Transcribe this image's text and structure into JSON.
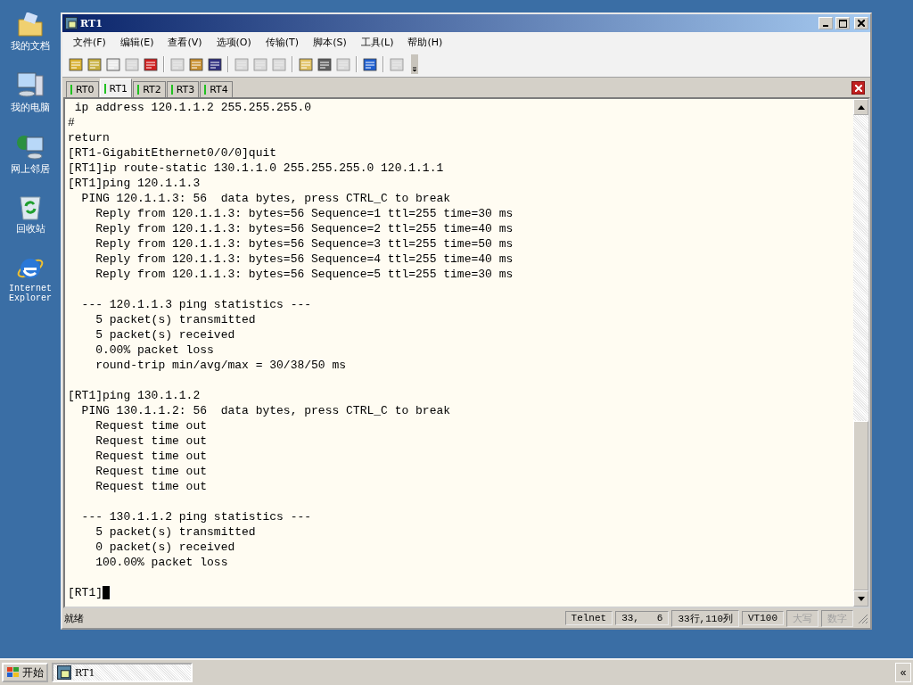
{
  "desktop_icons": [
    {
      "kind": "folder",
      "label": "我的文档"
    },
    {
      "kind": "computer",
      "label": "我的电脑"
    },
    {
      "kind": "network",
      "label": "网上邻居"
    },
    {
      "kind": "recycle",
      "label": "回收站"
    },
    {
      "kind": "ie",
      "label": "Internet Explorer"
    }
  ],
  "window": {
    "title": "RT1"
  },
  "menu": [
    "文件(F)",
    "编辑(E)",
    "查看(V)",
    "选项(O)",
    "传输(T)",
    "脚本(S)",
    "工具(L)",
    "帮助(H)"
  ],
  "toolbar": [
    {
      "kind": "new",
      "disabled": false
    },
    {
      "kind": "connect",
      "disabled": false
    },
    {
      "kind": "folder",
      "disabled": false
    },
    {
      "kind": "reconnect",
      "disabled": true
    },
    {
      "kind": "disconnect",
      "disabled": false
    },
    {
      "kind": "separator"
    },
    {
      "kind": "copy",
      "disabled": true
    },
    {
      "kind": "paste",
      "disabled": false
    },
    {
      "kind": "find",
      "disabled": false
    },
    {
      "kind": "separator"
    },
    {
      "kind": "print",
      "disabled": true
    },
    {
      "kind": "print",
      "disabled": true
    },
    {
      "kind": "print",
      "disabled": true
    },
    {
      "kind": "separator"
    },
    {
      "kind": "properties",
      "disabled": false
    },
    {
      "kind": "map",
      "disabled": false
    },
    {
      "kind": "key",
      "disabled": true
    },
    {
      "kind": "separator"
    },
    {
      "kind": "help",
      "disabled": false
    },
    {
      "kind": "separator"
    },
    {
      "kind": "window",
      "disabled": true
    }
  ],
  "tabs": [
    {
      "label": "RT0",
      "selected": false
    },
    {
      "label": "RT1",
      "selected": true
    },
    {
      "label": "RT2",
      "selected": false
    },
    {
      "label": "RT3",
      "selected": false
    },
    {
      "label": "RT4",
      "selected": false
    }
  ],
  "terminal": {
    "blocks": [
      [
        " ip address 120.1.1.2 255.255.255.0",
        "#",
        "return",
        "[RT1-GigabitEthernet0/0/0]quit",
        "[RT1]ip route-static 130.1.1.0 255.255.255.0 120.1.1.1",
        "[RT1]ping 120.1.1.3",
        "  PING 120.1.1.3: 56  data bytes, press CTRL_C to break",
        "    Reply from 120.1.1.3: bytes=56 Sequence=1 ttl=255 time=30 ms",
        "    Reply from 120.1.1.3: bytes=56 Sequence=2 ttl=255 time=40 ms",
        "    Reply from 120.1.1.3: bytes=56 Sequence=3 ttl=255 time=50 ms",
        "    Reply from 120.1.1.3: bytes=56 Sequence=4 ttl=255 time=40 ms",
        "    Reply from 120.1.1.3: bytes=56 Sequence=5 ttl=255 time=30 ms"
      ],
      [
        "  --- 120.1.1.3 ping statistics ---",
        "    5 packet(s) transmitted",
        "    5 packet(s) received",
        "    0.00% packet loss",
        "    round-trip min/avg/max = 30/38/50 ms"
      ],
      [
        "[RT1]ping 130.1.1.2",
        "  PING 130.1.1.2: 56  data bytes, press CTRL_C to break",
        "    Request time out",
        "    Request time out",
        "    Request time out",
        "    Request time out",
        "    Request time out"
      ],
      [
        "  --- 130.1.1.2 ping statistics ---",
        "    5 packet(s) transmitted",
        "    0 packet(s) received",
        "    100.00% packet loss"
      ],
      [
        "[RT1]"
      ]
    ]
  },
  "status_bar": {
    "message": "就绪",
    "panes": [
      {
        "text": "Telnet",
        "disabled": false
      },
      {
        "text": "33,   6",
        "disabled": false
      },
      {
        "text": "33行,110列",
        "disabled": false
      },
      {
        "text": "VT100",
        "disabled": false
      },
      {
        "text": "大写",
        "disabled": true
      },
      {
        "text": "数字",
        "disabled": true
      }
    ]
  },
  "taskbar": {
    "start": "开始",
    "tasks": [
      {
        "label": "RT1",
        "selected": true
      }
    ],
    "tray": "«"
  }
}
